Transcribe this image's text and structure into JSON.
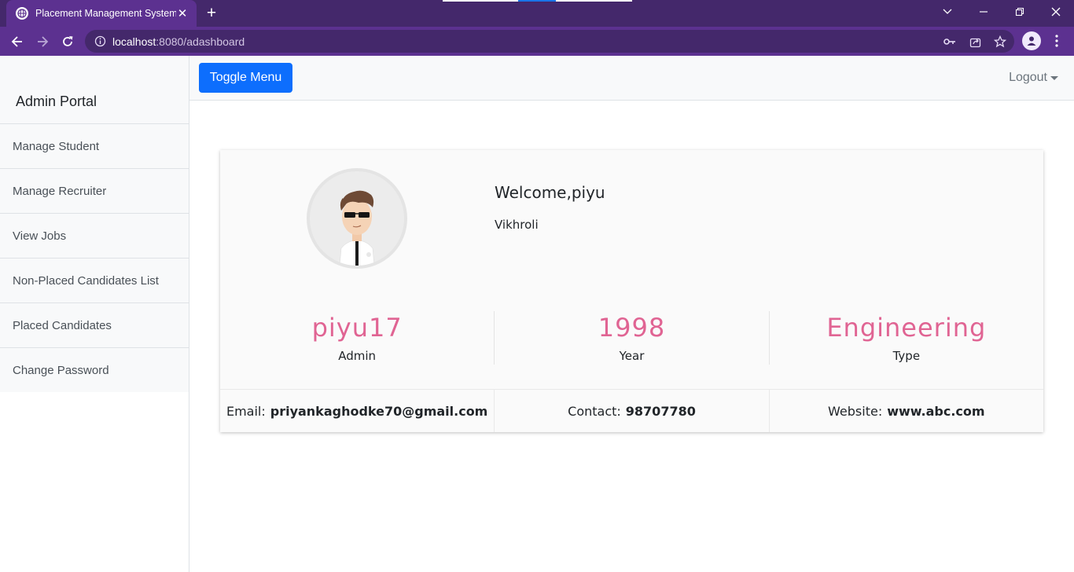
{
  "browser": {
    "tab_title": "Placement Management System",
    "url_host": "localhost",
    "url_rest": ":8080/adashboard"
  },
  "sidebar": {
    "heading": "Admin Portal",
    "items": [
      {
        "label": "Manage Student"
      },
      {
        "label": "Manage Recruiter"
      },
      {
        "label": "View Jobs"
      },
      {
        "label": "Non-Placed Candidates List"
      },
      {
        "label": "Placed Candidates"
      },
      {
        "label": "Change Password"
      }
    ]
  },
  "topnav": {
    "toggle_label": "Toggle Menu",
    "logout_label": "Logout"
  },
  "profile": {
    "welcome": "Welcome,piyu",
    "location": "Vikhroli",
    "stats": [
      {
        "value": "piyu17",
        "label": "Admin"
      },
      {
        "value": "1998",
        "label": "Year"
      },
      {
        "value": "Engineering",
        "label": "Type"
      }
    ],
    "contacts": [
      {
        "label": "Email:",
        "value": "priyankaghodke70@gmail.com"
      },
      {
        "label": "Contact:",
        "value": "98707780"
      },
      {
        "label": "Website:",
        "value": "www.abc.com"
      }
    ]
  },
  "colors": {
    "browser_frame": "#44286b",
    "browser_toolbar": "#5c3190",
    "primary_button": "#0d6efd",
    "stat_accent": "#e06493"
  },
  "icons": [
    "globe-icon",
    "close-icon",
    "plus-icon",
    "back-icon",
    "forward-icon",
    "reload-icon",
    "info-icon",
    "key-icon",
    "share-icon",
    "star-icon",
    "profile-icon",
    "menu-dots-icon",
    "avatar"
  ]
}
